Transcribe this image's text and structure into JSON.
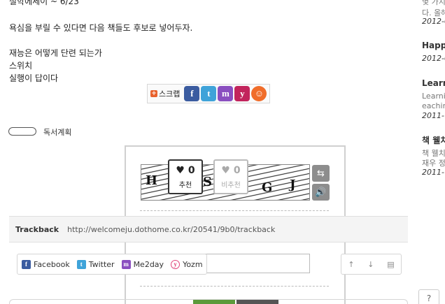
{
  "post": {
    "cut_line": "철학에세이 ~ 6/23",
    "line1": "욕심을 부릴 수 있다면 다음 책들도 후보로 넣어두자.",
    "line2": "재능은 어떻게 단련 되는가",
    "line3": "스위치",
    "line4": "실행이 답이다"
  },
  "scrap": {
    "label": "스크랩",
    "icons": [
      "facebook-icon",
      "twitter-icon",
      "me2day-icon",
      "yozm-icon",
      "other-icon"
    ]
  },
  "category": {
    "label": "독서계획"
  },
  "vote": {
    "up_count": "0",
    "up_label": "추천",
    "down_count": "0",
    "down_label": "비추천",
    "heart": "♥"
  },
  "captcha": {
    "chars": [
      "H",
      "S",
      "G",
      "J"
    ]
  },
  "trackback": {
    "title": "Trackback",
    "url": "http://welcomeju.dothome.co.kr/20541/9b0/trackback"
  },
  "share": {
    "items": [
      {
        "label": "Facebook",
        "icon": "facebook-icon",
        "glyph": "f"
      },
      {
        "label": "Twitter",
        "icon": "twitter-icon",
        "glyph": "t"
      },
      {
        "label": "Me2day",
        "icon": "me2day-icon",
        "glyph": "m"
      },
      {
        "label": "Yozm",
        "icon": "yozm-icon",
        "glyph": "y"
      }
    ]
  },
  "nav": {
    "up": "↑",
    "down": "↓",
    "print": "▤"
  },
  "sidebar": {
    "cut_top1": "몇 가지",
    "cut_top2": "다. 올해",
    "date1": "2012-0",
    "head2": "Happy",
    "date2": "2012-0",
    "head3": "Learn",
    "txt3a": "Learni",
    "txt3b": "eachin",
    "date3": "2011-",
    "head4": "책 웰치",
    "txt4a": "책 웰치",
    "txt4b": "재우 정",
    "date4": "2011-"
  },
  "help": {
    "label": "?"
  },
  "colors": {
    "facebook": "#3b5ca0",
    "twitter": "#3fa3d9",
    "me2day": "#8a4fc0",
    "yozm": "#c2245c",
    "trackback_bg": "#f4f4f4"
  }
}
